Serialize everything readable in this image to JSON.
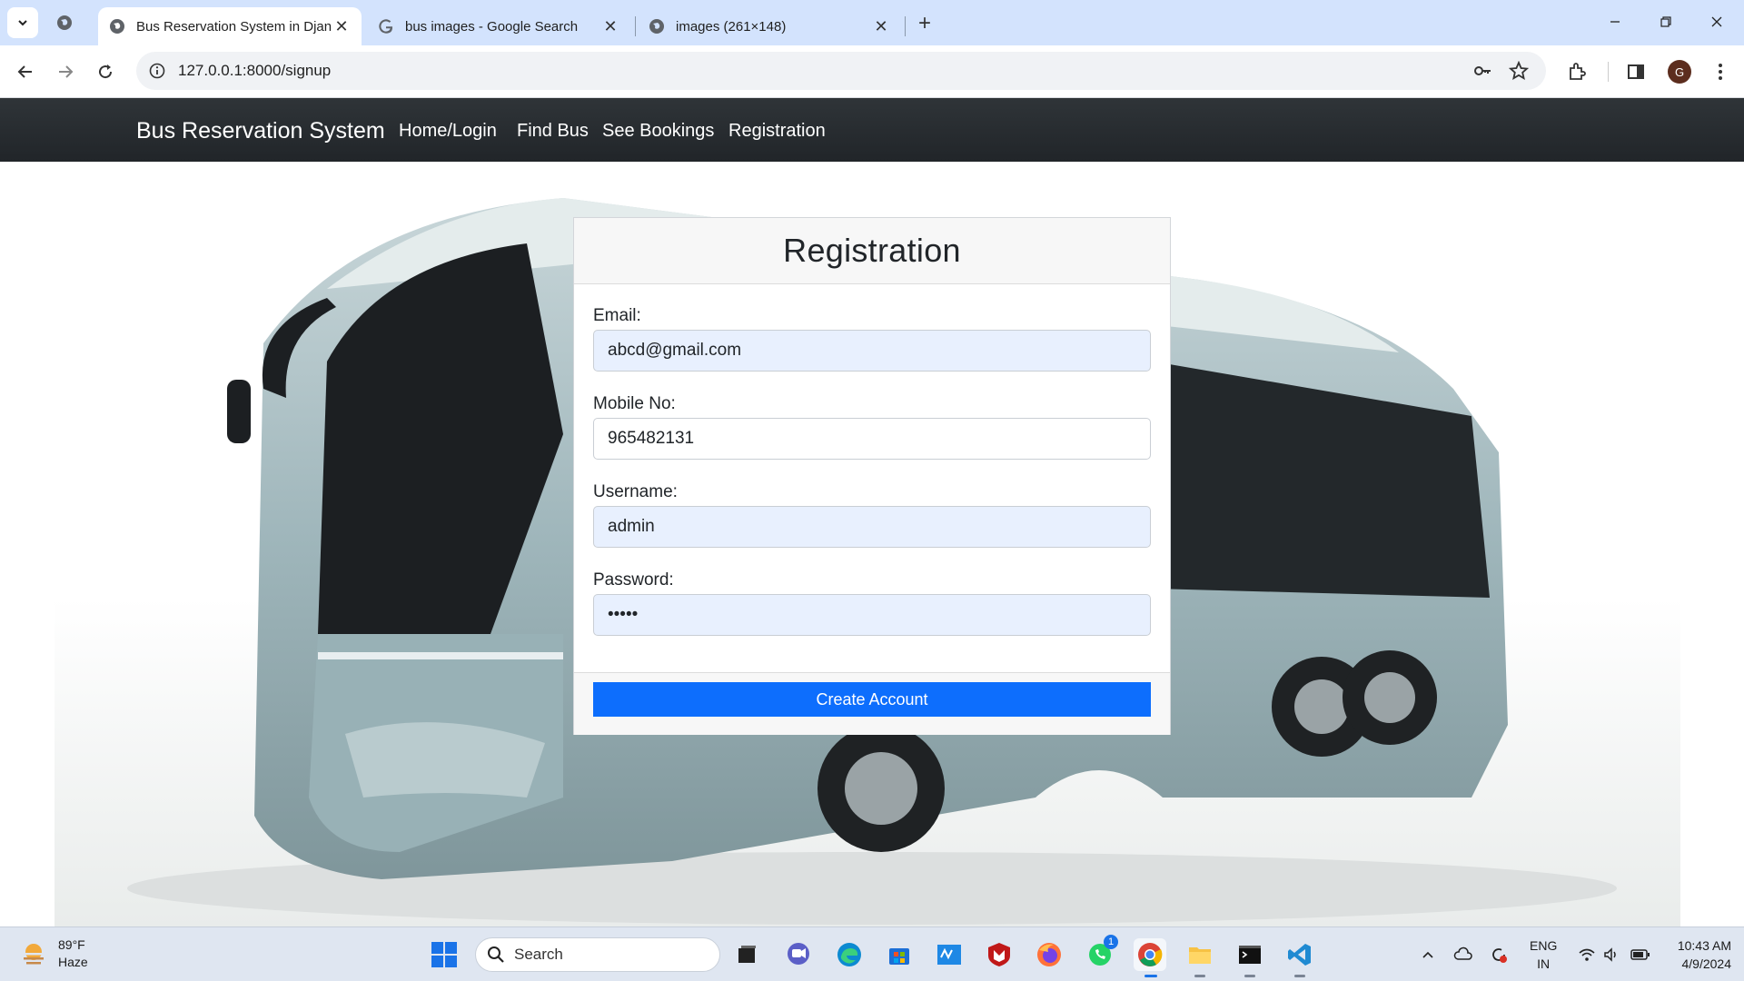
{
  "browser": {
    "tabs": [
      {
        "title": "Bus Reservation System in Djan",
        "active": true
      },
      {
        "title": "bus images - Google Search",
        "active": false
      },
      {
        "title": "images (261×148)",
        "active": false
      }
    ],
    "url": "127.0.0.1:8000/signup",
    "profile_initial": "G"
  },
  "navbar": {
    "brand": "Bus Reservation System",
    "links": [
      "Home/Login",
      "Find Bus",
      "See Bookings",
      "Registration"
    ]
  },
  "form": {
    "title": "Registration",
    "fields": [
      {
        "label": "Email:",
        "value": "abcd@gmail.com",
        "autofilled": true
      },
      {
        "label": "Mobile No:",
        "value": "965482131",
        "autofilled": false
      },
      {
        "label": "Username:",
        "value": "admin",
        "autofilled": true
      },
      {
        "label": "Password:",
        "value": "admin",
        "autofilled": true
      }
    ],
    "submit_label": "Create Account"
  },
  "taskbar": {
    "weather": {
      "temp": "89°F",
      "condition": "Haze"
    },
    "search_placeholder": "Search",
    "lang_line1": "ENG",
    "lang_line2": "IN",
    "time": "10:43 AM",
    "date": "4/9/2024",
    "whatsapp_badge": "1"
  },
  "colors": {
    "navbar_bg": "#212529",
    "primary_button": "#0d6efd",
    "autofill_bg": "#e8f0fe",
    "tabstrip_bg": "#d3e3fd"
  }
}
